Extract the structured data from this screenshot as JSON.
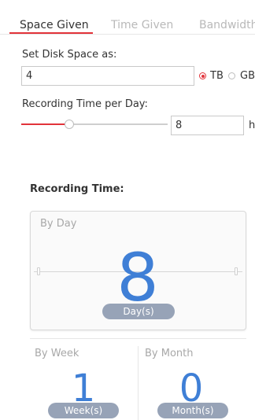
{
  "tabs": [
    {
      "label": "Space Given",
      "active": true
    },
    {
      "label": "Time Given",
      "active": false
    },
    {
      "label": "Bandwidth",
      "active": false
    }
  ],
  "disk_space": {
    "label": "Set Disk Space as:",
    "value": "4",
    "units": [
      {
        "label": "TB",
        "selected": true
      },
      {
        "label": "GB",
        "selected": false
      }
    ]
  },
  "recording_per_day": {
    "label": "Recording Time per Day:",
    "slider_fraction": 0.33,
    "value": "8",
    "unit": "h"
  },
  "recording_time": {
    "title": "Recording Time:",
    "by_day": {
      "caption": "By Day",
      "value": "8",
      "unit": "Day(s)"
    },
    "by_week": {
      "caption": "By Week",
      "value": "1",
      "unit": "Week(s)"
    },
    "by_month": {
      "caption": "By Month",
      "value": "0",
      "unit": "Month(s)"
    }
  },
  "colors": {
    "accent": "#e2333a",
    "number": "#3f7fd6",
    "pill": "#97a3b7"
  }
}
